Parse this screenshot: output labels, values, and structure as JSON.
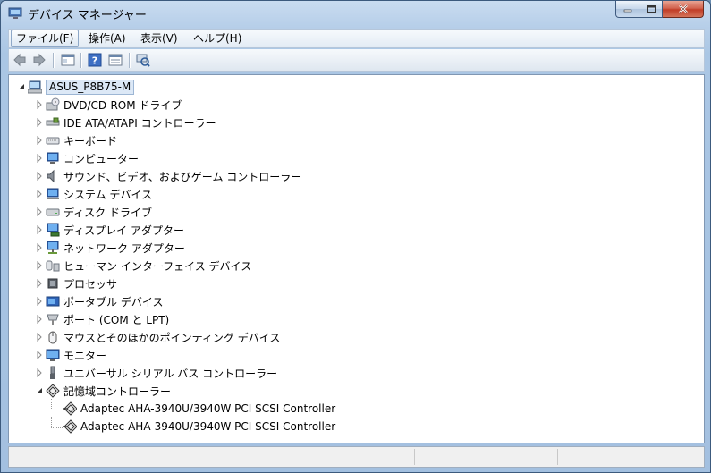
{
  "window": {
    "title": "デバイス マネージャー"
  },
  "menu": [
    {
      "label": "ファイル(F)",
      "name": "menu-file"
    },
    {
      "label": "操作(A)",
      "name": "menu-action"
    },
    {
      "label": "表示(V)",
      "name": "menu-view"
    },
    {
      "label": "ヘルプ(H)",
      "name": "menu-help"
    }
  ],
  "toolbar": [
    {
      "icon": "back-arrow-icon"
    },
    {
      "icon": "forward-arrow-icon"
    },
    {
      "icon": "show-hide-console-tree-icon"
    },
    {
      "icon": "help-icon"
    },
    {
      "icon": "properties-icon"
    },
    {
      "icon": "scan-hardware-changes-icon"
    }
  ],
  "tree": {
    "root": {
      "label": "ASUS_P8B75-M",
      "icon": "computer-icon"
    },
    "categories": [
      {
        "label": "DVD/CD-ROM ドライブ",
        "icon": "dvd-drive-icon"
      },
      {
        "label": "IDE ATA/ATAPI コントローラー",
        "icon": "ide-controller-icon"
      },
      {
        "label": "キーボード",
        "icon": "keyboard-icon"
      },
      {
        "label": "コンピューター",
        "icon": "computer-monitor-icon"
      },
      {
        "label": "サウンド、ビデオ、およびゲーム コントローラー",
        "icon": "speaker-icon"
      },
      {
        "label": "システム デバイス",
        "icon": "system-device-icon"
      },
      {
        "label": "ディスク ドライブ",
        "icon": "disk-drive-icon"
      },
      {
        "label": "ディスプレイ アダプター",
        "icon": "display-adapter-icon"
      },
      {
        "label": "ネットワーク アダプター",
        "icon": "network-adapter-icon"
      },
      {
        "label": "ヒューマン インターフェイス デバイス",
        "icon": "hid-icon"
      },
      {
        "label": "プロセッサ",
        "icon": "processor-icon"
      },
      {
        "label": "ポータブル デバイス",
        "icon": "portable-device-icon"
      },
      {
        "label": "ポート (COM と LPT)",
        "icon": "port-icon"
      },
      {
        "label": "マウスとそのほかのポインティング デバイス",
        "icon": "mouse-icon"
      },
      {
        "label": "モニター",
        "icon": "monitor-icon"
      },
      {
        "label": "ユニバーサル シリアル バス コントローラー",
        "icon": "usb-icon"
      },
      {
        "label": "記憶域コントローラー",
        "icon": "storage-controller-icon",
        "expanded": true,
        "children": [
          {
            "label": "Adaptec AHA-3940U/3940W PCI SCSI Controller",
            "icon": "scsi-controller-icon"
          },
          {
            "label": "Adaptec AHA-3940U/3940W PCI SCSI Controller",
            "icon": "scsi-controller-icon"
          }
        ]
      }
    ]
  },
  "colors": {
    "selection": "#dce8f6",
    "titlebar": "#c9dcf0",
    "close_button": "#c13d27"
  }
}
